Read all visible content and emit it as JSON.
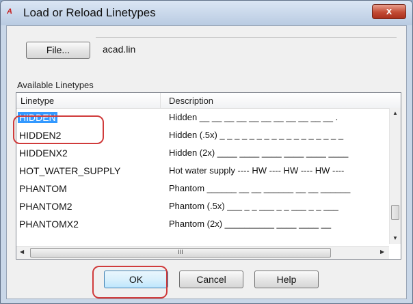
{
  "window": {
    "icon_text": "A",
    "title": "Load or Reload Linetypes",
    "close_glyph": "x"
  },
  "file": {
    "button_label": "File...",
    "value": "acad.lin"
  },
  "list": {
    "group_label": "Available Linetypes",
    "headers": {
      "linetype": "Linetype",
      "description": "Description"
    },
    "rows": [
      {
        "name": "HIDDEN",
        "desc": "Hidden __ __ __ __ __ __ __ __ __ __ __ .",
        "selected": true
      },
      {
        "name": "HIDDEN2",
        "desc": "Hidden (.5x) _ _ _ _ _ _ _ _ _ _ _ _ _ _ _ _ _"
      },
      {
        "name": "HIDDENX2",
        "desc": "Hidden (2x) ____ ____ ____ ____ ____ ____"
      },
      {
        "name": "HOT_WATER_SUPPLY",
        "desc": "Hot water supply ---- HW ---- HW ---- HW ----"
      },
      {
        "name": "PHANTOM",
        "desc": "Phantom ______ __ __ ______ __ __ ______"
      },
      {
        "name": "PHANTOM2",
        "desc": "Phantom (.5x) ___ _ _ ___ _ _ ___ _ _ ___"
      },
      {
        "name": "PHANTOMX2",
        "desc": "Phantom (2x) __________ ____ ____ __"
      }
    ],
    "scroll_thumb_glyph": "III"
  },
  "buttons": {
    "ok": "OK",
    "cancel": "Cancel",
    "help": "Help"
  },
  "colors": {
    "selection": "#3399ff",
    "highlight_marker": "#d03b3b"
  }
}
